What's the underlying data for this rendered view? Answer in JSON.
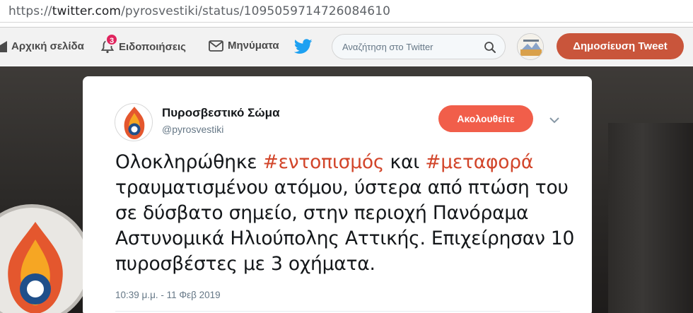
{
  "browser": {
    "url_scheme": "https://",
    "url_domain": "twitter.com",
    "url_path": "/pyrosvestiki/status/1095059714726084610"
  },
  "nav": {
    "home_label": "Αρχική σελίδα",
    "notifications_label": "Ειδοποιήσεις",
    "notifications_count": "3",
    "messages_label": "Μηνύματα",
    "search_placeholder": "Αναζήτηση στο Twitter",
    "tweet_button_label": "Δημοσίευση Tweet"
  },
  "tweet": {
    "author_name": "Πυροσβεστικό Σώμα",
    "author_handle": "@pyrosvestiki",
    "follow_label": "Ακολουθείτε",
    "text_part1": "Ολοκληρώθηκε ",
    "hashtag1": "#εντοπισμός",
    "text_part2": " και ",
    "hashtag2": "#μεταφορά",
    "text_part3": " τραυματισμένου ατόμου, ύστερα από πτώση του σε δύσβατο σημείο, στην περιοχή Πανόραμα Αστυνομικά Ηλιούπολης Αττικής. Επιχείρησαν 10 πυροσβέστες με 3 οχήματα.",
    "timestamp": "10:39 μ.μ. - 11 Φεβ 2019"
  },
  "colors": {
    "accent": "#f15e4a",
    "hashtag": "#d2452a",
    "twitter_blue": "#1da1f2",
    "tweet_button": "#c9553b"
  },
  "icons": [
    "home-icon",
    "bell-icon",
    "envelope-icon",
    "twitter-bird-icon",
    "search-icon",
    "chevron-down-icon"
  ]
}
